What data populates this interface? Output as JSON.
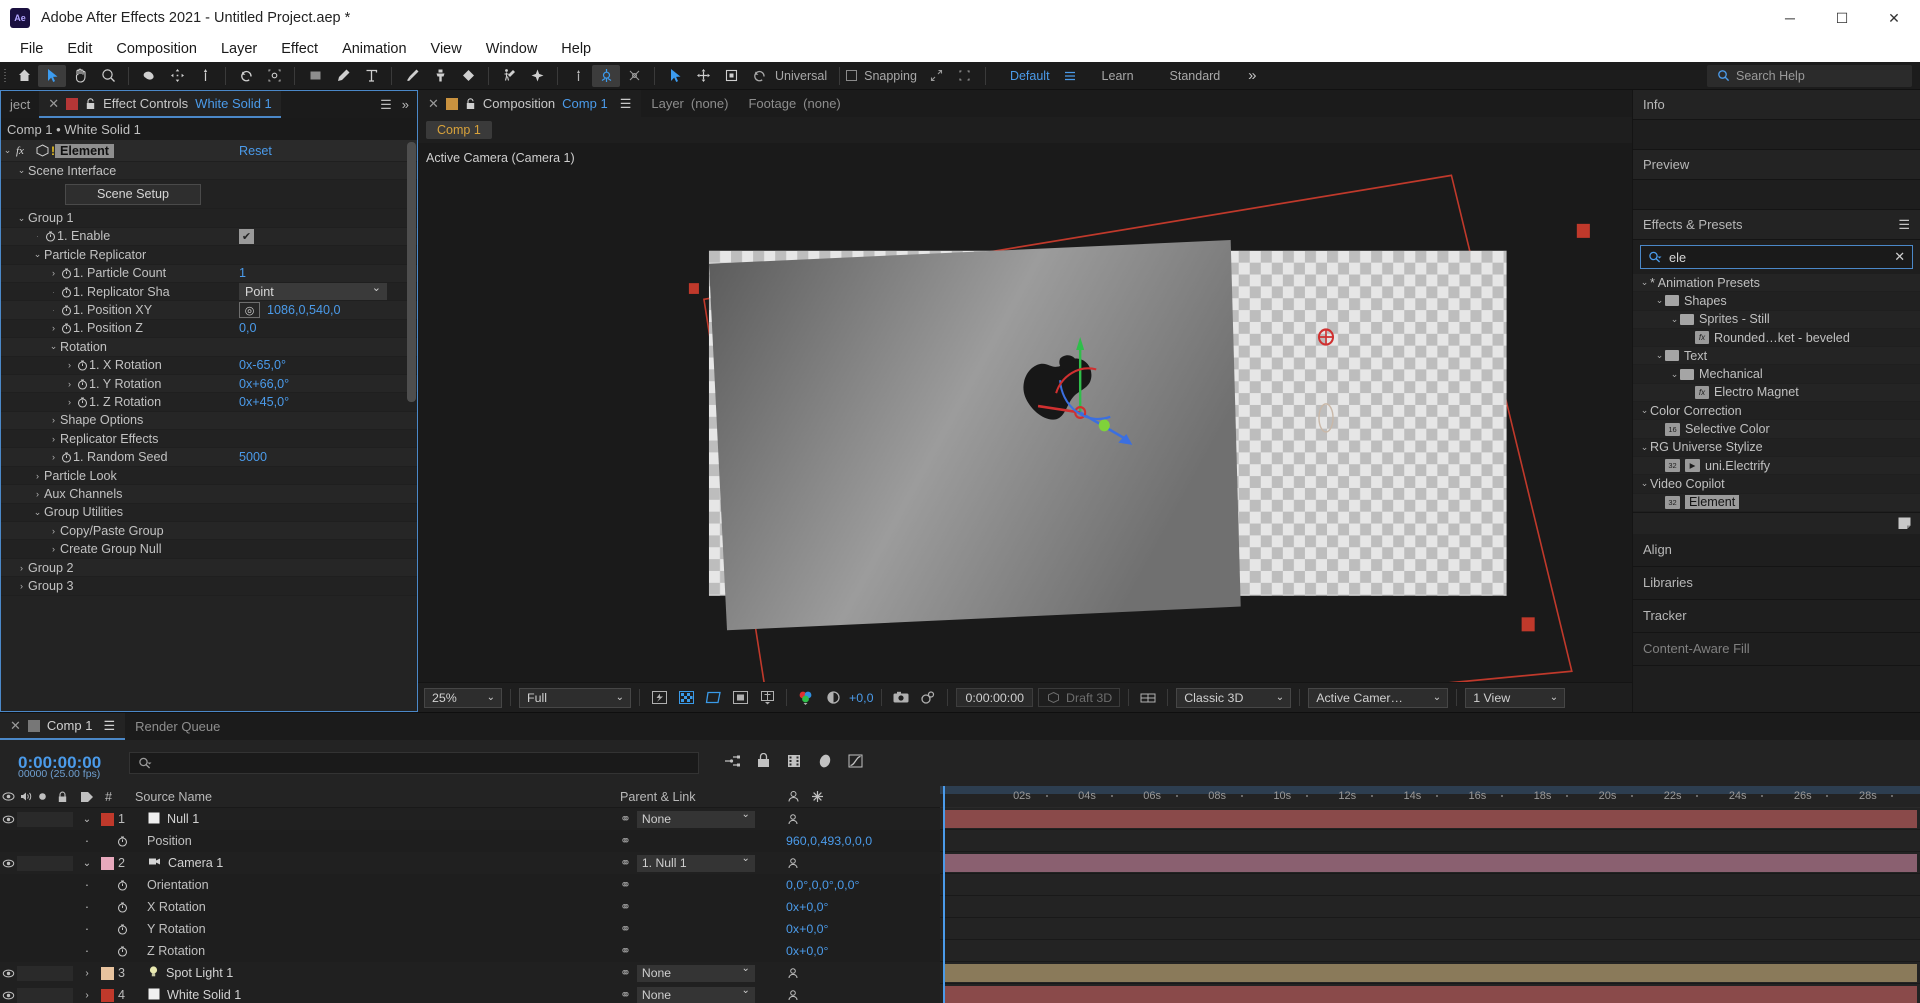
{
  "titlebar": {
    "app_icon": "ae-logo",
    "title": "Adobe After Effects 2021 - Untitled Project.aep *",
    "minimize": "─",
    "maximize": "☐",
    "close": "✕"
  },
  "menubar": {
    "items": [
      "File",
      "Edit",
      "Composition",
      "Layer",
      "Effect",
      "Animation",
      "View",
      "Window",
      "Help"
    ]
  },
  "toolbar": {
    "universal_label": "Universal",
    "snapping_label": "Snapping",
    "workspaces": [
      "Default",
      "Learn",
      "Standard"
    ],
    "active_workspace": "Default",
    "search_help_placeholder": "Search Help",
    "overflow": "»"
  },
  "effect_controls": {
    "tab_project": "ject",
    "tab_close": "✕",
    "tab_title": "Effect Controls",
    "tab_layer": "White Solid 1",
    "breadcrumb": "Comp 1 • White Solid 1",
    "effect_name": "Element",
    "reset_label": "Reset",
    "scene_interface": "Scene Interface",
    "scene_setup_button": "Scene Setup",
    "rows": [
      {
        "label": "Group 1",
        "indent": 1,
        "tw": "⌄",
        "value": ""
      },
      {
        "label": "1. Enable",
        "indent": 2,
        "tw": "",
        "value": "",
        "control": "checkbox"
      },
      {
        "label": "Particle Replicator",
        "indent": 2,
        "tw": "⌄",
        "value": ""
      },
      {
        "label": "1. Particle Count",
        "indent": 3,
        "tw": "›",
        "value": "1"
      },
      {
        "label": "1. Replicator Sha",
        "indent": 3,
        "tw": "",
        "value": "Point",
        "control": "dropdown"
      },
      {
        "label": "1. Position XY",
        "indent": 3,
        "tw": "",
        "value": "1086,0,540,0",
        "control": "xy"
      },
      {
        "label": "1. Position Z",
        "indent": 3,
        "tw": "›",
        "value": "0,0"
      },
      {
        "label": "Rotation",
        "indent": 3,
        "tw": "⌄",
        "value": ""
      },
      {
        "label": "1. X Rotation",
        "indent": 4,
        "tw": "›",
        "value": "0x-65,0°"
      },
      {
        "label": "1. Y Rotation",
        "indent": 4,
        "tw": "›",
        "value": "0x+66,0°"
      },
      {
        "label": "1. Z Rotation",
        "indent": 4,
        "tw": "›",
        "value": "0x+45,0°"
      },
      {
        "label": "Shape Options",
        "indent": 3,
        "tw": "›",
        "value": ""
      },
      {
        "label": "Replicator Effects",
        "indent": 3,
        "tw": "›",
        "value": ""
      },
      {
        "label": "1. Random Seed",
        "indent": 3,
        "tw": "›",
        "value": "5000"
      },
      {
        "label": "Particle Look",
        "indent": 2,
        "tw": "›",
        "value": ""
      },
      {
        "label": "Aux Channels",
        "indent": 2,
        "tw": "›",
        "value": ""
      },
      {
        "label": "Group Utilities",
        "indent": 2,
        "tw": "⌄",
        "value": ""
      },
      {
        "label": "Copy/Paste Group",
        "indent": 3,
        "tw": "›",
        "value": ""
      },
      {
        "label": "Create Group Null",
        "indent": 3,
        "tw": "›",
        "value": ""
      },
      {
        "label": "Group 2",
        "indent": 1,
        "tw": "›",
        "value": ""
      },
      {
        "label": "Group 3",
        "indent": 1,
        "tw": "›",
        "value": ""
      }
    ]
  },
  "composition": {
    "tab_close": "✕",
    "tab_title": "Composition",
    "tab_name": "Comp 1",
    "tab_layer": "Layer",
    "tab_layer_val": "(none)",
    "tab_footage": "Footage",
    "tab_footage_val": "(none)",
    "sub_chip": "Comp 1",
    "camera_label": "Active Camera (Camera 1)",
    "bottom": {
      "zoom": "25%",
      "resolution": "Full",
      "exposure": "+0,0",
      "timecode": "0:00:00:00",
      "draft3d": "Draft 3D",
      "renderer": "Classic 3D",
      "camera": "Active Camer…",
      "views": "1 View"
    }
  },
  "right_panels": {
    "info": "Info",
    "preview": "Preview",
    "effects_presets": "Effects & Presets",
    "menu_icon": "☰",
    "search_value": "ele",
    "search_clear": "✕",
    "tree": [
      {
        "label": "* Animation Presets",
        "indent": 0,
        "tw": "⌄",
        "icon": "none"
      },
      {
        "label": "Shapes",
        "indent": 1,
        "tw": "⌄",
        "icon": "folder"
      },
      {
        "label": "Sprites - Still",
        "indent": 2,
        "tw": "⌄",
        "icon": "folder"
      },
      {
        "label": "Rounded…ket - beveled",
        "indent": 3,
        "tw": "",
        "icon": "fx"
      },
      {
        "label": "Text",
        "indent": 1,
        "tw": "⌄",
        "icon": "folder"
      },
      {
        "label": "Mechanical",
        "indent": 2,
        "tw": "⌄",
        "icon": "folder"
      },
      {
        "label": "Electro Magnet",
        "indent": 3,
        "tw": "",
        "icon": "fx"
      },
      {
        "label": "Color Correction",
        "indent": 0,
        "tw": "⌄",
        "icon": "none"
      },
      {
        "label": "Selective Color",
        "indent": 1,
        "tw": "",
        "icon": "b16"
      },
      {
        "label": "RG Universe Stylize",
        "indent": 0,
        "tw": "⌄",
        "icon": "none"
      },
      {
        "label": "uni.Electrify",
        "indent": 1,
        "tw": "",
        "icon": "b32fx"
      },
      {
        "label": "Video Copilot",
        "indent": 0,
        "tw": "⌄",
        "icon": "none"
      },
      {
        "label": "Element",
        "indent": 1,
        "tw": "",
        "icon": "b32",
        "selected": true
      }
    ],
    "align": "Align",
    "libraries": "Libraries",
    "tracker": "Tracker",
    "content_aware": "Content-Aware Fill"
  },
  "timeline": {
    "tab_comp": "Comp 1",
    "tab_render": "Render Queue",
    "current_time": "0:00:00:00",
    "frame_info": "00000 (25.00 fps)",
    "search_placeholder": "",
    "headers": {
      "num": "#",
      "source_name": "Source Name",
      "parent_link": "Parent & Link"
    },
    "ruler_ticks": [
      "02s",
      "04s",
      "06s",
      "08s",
      "10s",
      "12s",
      "14s",
      "16s",
      "18s",
      "20s",
      "22s",
      "24s",
      "26s",
      "28s"
    ],
    "layers": [
      {
        "num": "1",
        "name": "Null 1",
        "parent": "None",
        "color": "#c0392b",
        "type": "null",
        "expanded": true,
        "bar_color": "#8a4a4a",
        "props": [
          {
            "label": "Position",
            "value": "960,0,493,0,0,0"
          }
        ]
      },
      {
        "num": "2",
        "name": "Camera 1",
        "parent": "1. Null 1",
        "color": "#e8a9bd",
        "type": "camera",
        "expanded": true,
        "bar_color": "#8a6070",
        "props": [
          {
            "label": "Orientation",
            "value": "0,0°,0,0°,0,0°"
          },
          {
            "label": "X Rotation",
            "value": "0x+0,0°"
          },
          {
            "label": "Y Rotation",
            "value": "0x+0,0°"
          },
          {
            "label": "Z Rotation",
            "value": "0x+0,0°"
          }
        ]
      },
      {
        "num": "3",
        "name": "Spot Light 1",
        "parent": "None",
        "color": "#e8c39e",
        "type": "light",
        "expanded": false,
        "bar_color": "#8a7a5a",
        "props": []
      },
      {
        "num": "4",
        "name": "White Solid 1",
        "parent": "None",
        "color": "#c0392b",
        "type": "solid",
        "expanded": false,
        "bar_color": "#8a4a4a",
        "props": []
      }
    ]
  },
  "colors": {
    "accent_blue": "#4b9bea",
    "panel_bg": "#232323",
    "app_bg": "#1e1e1e",
    "guide_red": "#c0392b"
  }
}
